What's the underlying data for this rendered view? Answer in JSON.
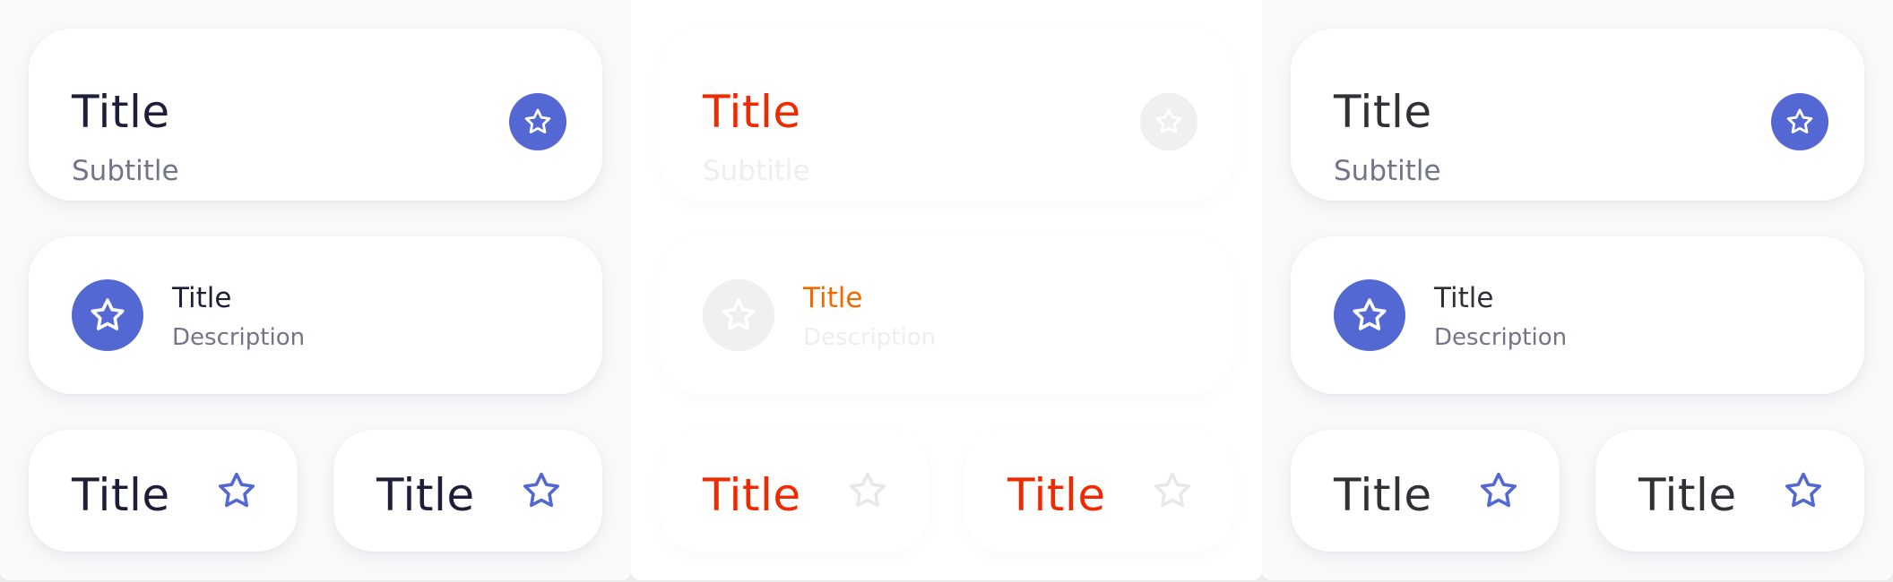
{
  "colors": {
    "accent": "#5468d4",
    "title_dark": "#1d1f3a",
    "title_gray": "#303036",
    "subtitle": "#72758a",
    "error_title": "#f02a00",
    "disabled_text": "#eeeef0",
    "disabled_circle": "#f0f0f0"
  },
  "panels": [
    {
      "state": "default",
      "big_card": {
        "title": "Title",
        "subtitle": "Subtitle",
        "icon": "star-icon"
      },
      "mid_card": {
        "title": "Title",
        "description": "Description",
        "icon": "star-icon"
      },
      "small_cards": [
        {
          "title": "Title",
          "icon": "star-outline-icon"
        },
        {
          "title": "Title",
          "icon": "star-outline-icon"
        }
      ]
    },
    {
      "state": "disabled",
      "big_card": {
        "title": "Title",
        "subtitle": "Subtitle",
        "icon": "star-icon"
      },
      "mid_card": {
        "title": "Title",
        "description": "Description",
        "icon": "star-icon"
      },
      "small_cards": [
        {
          "title": "Title",
          "icon": "star-outline-icon"
        },
        {
          "title": "Title",
          "icon": "star-outline-icon"
        }
      ]
    },
    {
      "state": "default",
      "big_card": {
        "title": "Title",
        "subtitle": "Subtitle",
        "icon": "star-icon"
      },
      "mid_card": {
        "title": "Title",
        "description": "Description",
        "icon": "star-icon"
      },
      "small_cards": [
        {
          "title": "Title",
          "icon": "star-outline-icon"
        },
        {
          "title": "Title",
          "icon": "star-outline-icon"
        }
      ]
    }
  ]
}
